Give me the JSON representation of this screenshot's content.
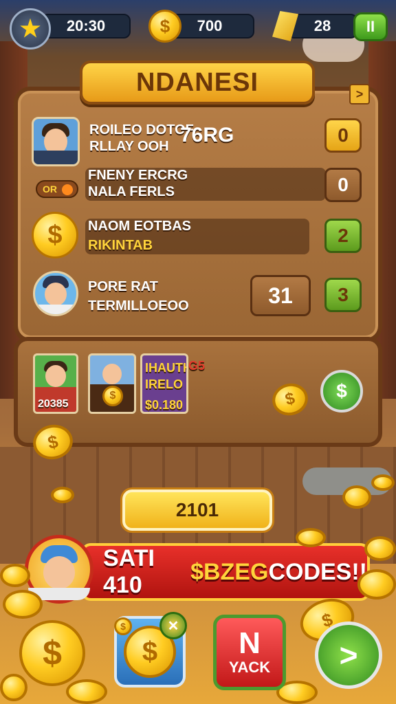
{
  "topbar": {
    "level_value": "20:30",
    "coins_value": "700",
    "gems_value": "28",
    "star_icon": "★",
    "coin_symbol": "$",
    "pause_icon": "II"
  },
  "banner": {
    "title": "NDANESI",
    "corner_icon": ">"
  },
  "rows": [
    {
      "line1": "ROILEO  DOTOF",
      "line2": "RLLAY  OOH",
      "big": "76RG",
      "score": "0"
    },
    {
      "line1": "FNENY ERCRG",
      "line2": "NALA FERLS",
      "badge": "OR",
      "score": "0"
    },
    {
      "line1": "NAOM  EOTBAS",
      "line2": "RIKINTAB",
      "score": "2"
    },
    {
      "line1": "PORE RAT",
      "line2": "TERMILLOEOO",
      "value": "31",
      "score": "3"
    }
  ],
  "shelf": {
    "card1_label": "20385",
    "card3_line1": "IHAUTH",
    "card3_line1_suffix": "G5",
    "card3_line2": "IRELO",
    "card3_line3": "$0.180",
    "green_coin": "$"
  },
  "mid_button": {
    "label": "2101"
  },
  "promo": {
    "part1": "SATI 410 ",
    "part2": "$BZEG",
    "part3": "CODES!!"
  },
  "bottom": {
    "coin_card_symbol": "$",
    "hack_label": "YACK",
    "hack_top": "N",
    "next_icon": ">"
  },
  "colors": {
    "accent_gold": "#ffd43b",
    "wood": "#9a6634",
    "promo_red": "#d0221c",
    "green": "#5c9b1d"
  }
}
